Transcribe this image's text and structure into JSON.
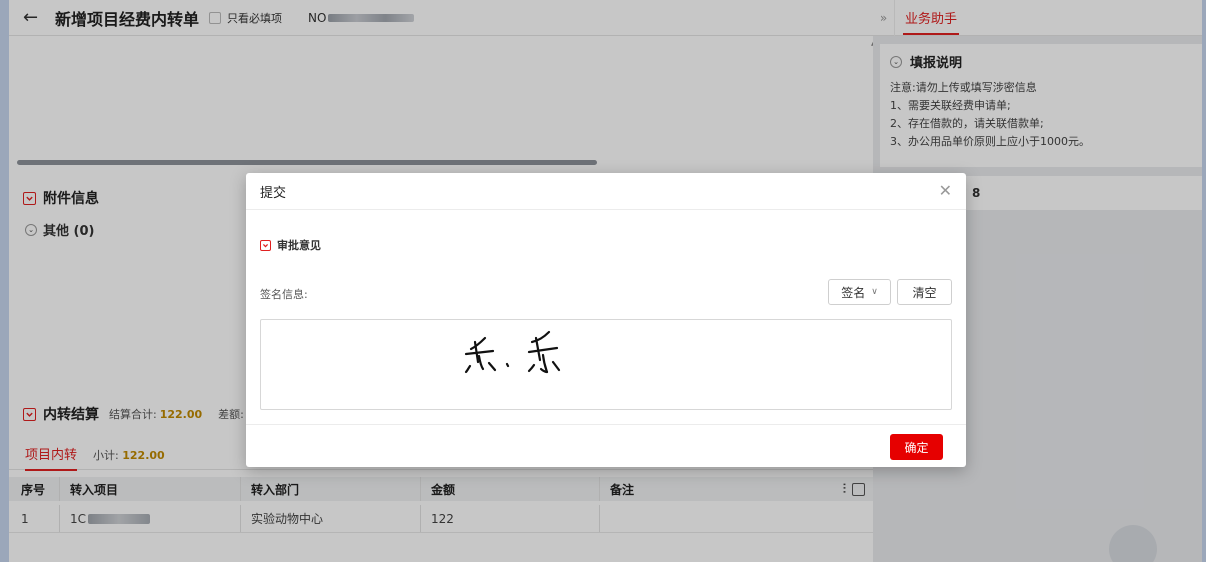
{
  "header": {
    "title": "新增项目经费内转单",
    "required_only_label": "只看必填项",
    "no_label": "NO"
  },
  "attachments": {
    "title": "附件信息",
    "other_label": "其他 (0)"
  },
  "settlement": {
    "title": "内转结算",
    "total_label": "结算合计:",
    "total_value": "122.00",
    "diff_label": "差额:"
  },
  "tabs": {
    "active_label": "项目内转",
    "subtotal_label": "小计:",
    "subtotal_value": "122.00"
  },
  "grid": {
    "columns": [
      "序号",
      "转入项目",
      "转入部门",
      "金额",
      "备注"
    ],
    "rows": [
      {
        "index": "1",
        "project_prefix": "1C",
        "department": "实验动物中心",
        "amount": "122",
        "remark": ""
      }
    ]
  },
  "side_panel": {
    "tab_label": "业务助手",
    "card_title": "填报说明",
    "lines": [
      "注意:请勿上传或填写涉密信息",
      "1、需要关联经费申请单;",
      "2、存在借款的，请关联借款单;",
      "3、办公用品单价原则上应小于1000元。"
    ],
    "card2_fragment": "8"
  },
  "modal": {
    "title": "提交",
    "approval_label": "审批意见",
    "sign_info_label": "签名信息:",
    "sign_select_label": "签名",
    "clear_label": "清空",
    "confirm_label": "确定"
  },
  "colors": {
    "accent_red": "#e02020",
    "button_red": "#e60000",
    "amount_gold": "#c08a00"
  },
  "icons": [
    "back-arrow-icon",
    "checkbox-icon",
    "collapse-box-icon",
    "chevron-down-icon",
    "close-icon",
    "column-settings-icon",
    "fullscreen-icon",
    "double-chevron-right-icon"
  ]
}
